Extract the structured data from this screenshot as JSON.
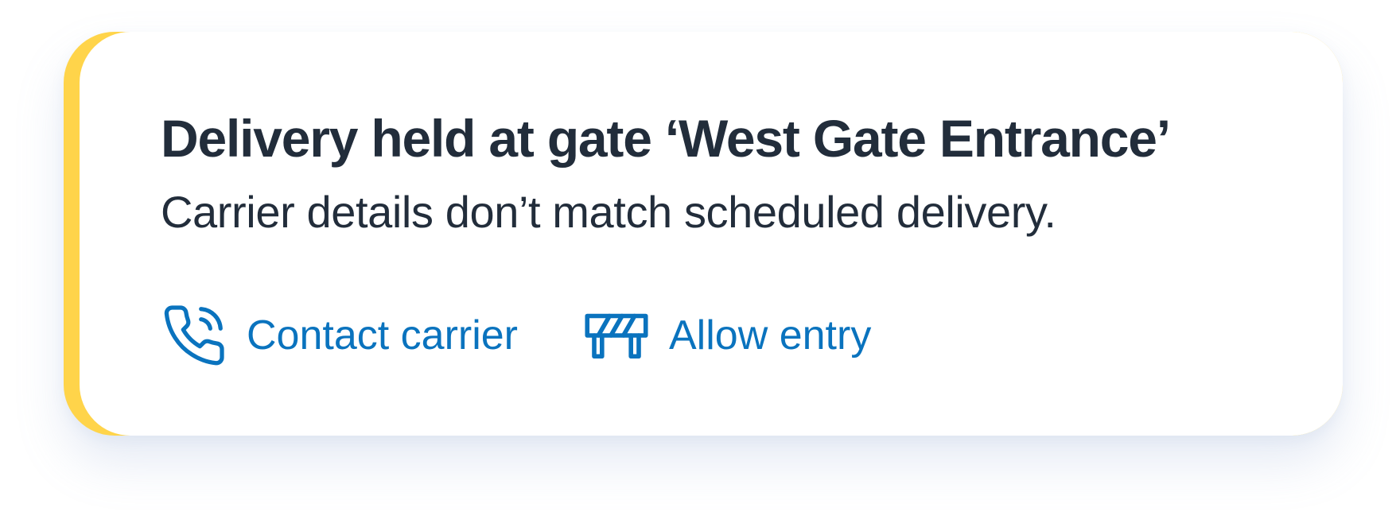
{
  "alert": {
    "title": "Delivery held at gate ‘West Gate Entrance’",
    "message": "Carrier details don’t match scheduled delivery.",
    "accent_color": "#FFD44A",
    "text_color": "#222D3B",
    "link_color": "#0A73BE",
    "actions": [
      {
        "label": "Contact carrier",
        "icon": "phone-call-icon"
      },
      {
        "label": "Allow entry",
        "icon": "barrier-icon"
      }
    ]
  }
}
